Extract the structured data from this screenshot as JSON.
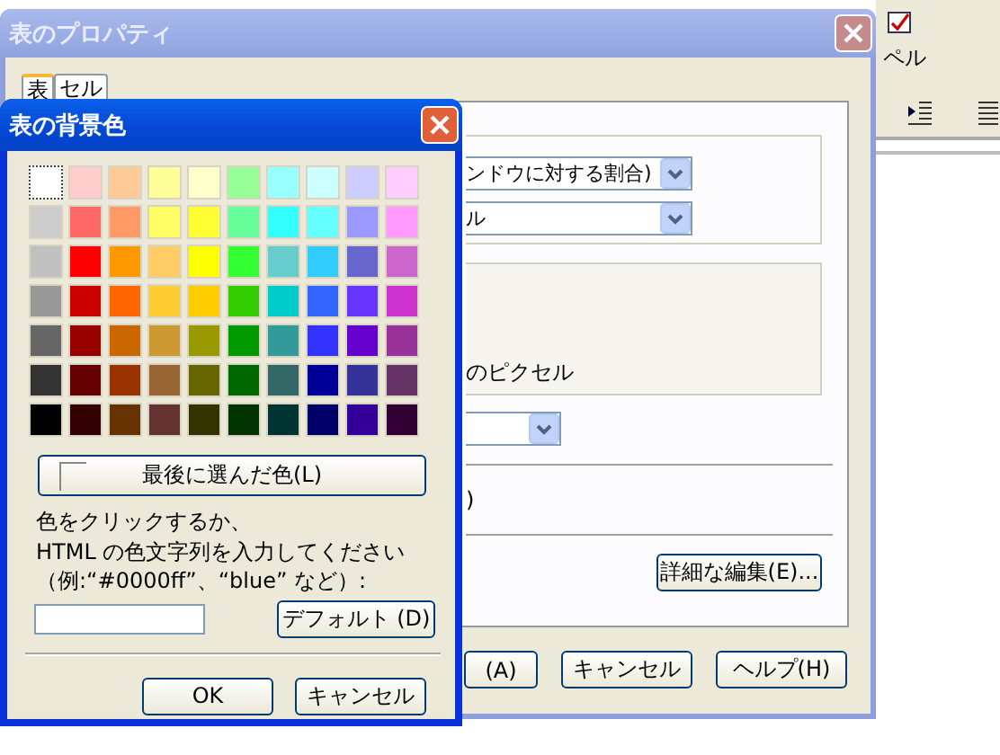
{
  "background_app": {
    "toolbar_label": "ペル"
  },
  "properties_dialog": {
    "title": "表のプロパティ",
    "tabs": [
      {
        "label": "表",
        "selected": true
      },
      {
        "label": "セル",
        "selected": false
      }
    ],
    "size_select": "ンドウに対する割合)",
    "unit_select": "ル",
    "pixel_label": "のピクセル",
    "note_text": ")",
    "advanced_button": "詳細な編集(E)...",
    "buttons": [
      "(A)",
      "キャンセル",
      "ヘルプ(H)"
    ]
  },
  "color_dialog": {
    "title": "表の背景色",
    "palette": [
      {
        "color": "#ffffff",
        "selected": true
      },
      {
        "color": "#ffcccc",
        "selected": false
      },
      {
        "color": "#ffcc99",
        "selected": false
      },
      {
        "color": "#ffff99",
        "selected": false
      },
      {
        "color": "#ffffcc",
        "selected": false
      },
      {
        "color": "#99ff99",
        "selected": false
      },
      {
        "color": "#99ffff",
        "selected": false
      },
      {
        "color": "#ccffff",
        "selected": false
      },
      {
        "color": "#ccccff",
        "selected": false
      },
      {
        "color": "#ffccff",
        "selected": false
      },
      {
        "color": "#cccccc",
        "selected": false
      },
      {
        "color": "#ff6666",
        "selected": false
      },
      {
        "color": "#ff9966",
        "selected": false
      },
      {
        "color": "#ffff66",
        "selected": false
      },
      {
        "color": "#ffff33",
        "selected": false
      },
      {
        "color": "#66ff99",
        "selected": false
      },
      {
        "color": "#33ffff",
        "selected": false
      },
      {
        "color": "#66ffff",
        "selected": false
      },
      {
        "color": "#9999ff",
        "selected": false
      },
      {
        "color": "#ff99ff",
        "selected": false
      },
      {
        "color": "#c0c0c0",
        "selected": false
      },
      {
        "color": "#ff0000",
        "selected": false
      },
      {
        "color": "#ff9900",
        "selected": false
      },
      {
        "color": "#ffcc66",
        "selected": false
      },
      {
        "color": "#ffff00",
        "selected": false
      },
      {
        "color": "#33ff33",
        "selected": false
      },
      {
        "color": "#66cccc",
        "selected": false
      },
      {
        "color": "#33ccff",
        "selected": false
      },
      {
        "color": "#6666cc",
        "selected": false
      },
      {
        "color": "#cc66cc",
        "selected": false
      },
      {
        "color": "#999999",
        "selected": false
      },
      {
        "color": "#cc0000",
        "selected": false
      },
      {
        "color": "#ff6600",
        "selected": false
      },
      {
        "color": "#ffcc33",
        "selected": false
      },
      {
        "color": "#ffcc00",
        "selected": false
      },
      {
        "color": "#33cc00",
        "selected": false
      },
      {
        "color": "#00cccc",
        "selected": false
      },
      {
        "color": "#3366ff",
        "selected": false
      },
      {
        "color": "#6633ff",
        "selected": false
      },
      {
        "color": "#cc33cc",
        "selected": false
      },
      {
        "color": "#666666",
        "selected": false
      },
      {
        "color": "#990000",
        "selected": false
      },
      {
        "color": "#cc6600",
        "selected": false
      },
      {
        "color": "#cc9933",
        "selected": false
      },
      {
        "color": "#999900",
        "selected": false
      },
      {
        "color": "#009900",
        "selected": false
      },
      {
        "color": "#339999",
        "selected": false
      },
      {
        "color": "#3333ff",
        "selected": false
      },
      {
        "color": "#6600cc",
        "selected": false
      },
      {
        "color": "#993399",
        "selected": false
      },
      {
        "color": "#333333",
        "selected": false
      },
      {
        "color": "#660000",
        "selected": false
      },
      {
        "color": "#993300",
        "selected": false
      },
      {
        "color": "#996633",
        "selected": false
      },
      {
        "color": "#666600",
        "selected": false
      },
      {
        "color": "#006600",
        "selected": false
      },
      {
        "color": "#336666",
        "selected": false
      },
      {
        "color": "#000099",
        "selected": false
      },
      {
        "color": "#333399",
        "selected": false
      },
      {
        "color": "#663366",
        "selected": false
      },
      {
        "color": "#000000",
        "selected": false
      },
      {
        "color": "#330000",
        "selected": false
      },
      {
        "color": "#663300",
        "selected": false
      },
      {
        "color": "#663333",
        "selected": false
      },
      {
        "color": "#333300",
        "selected": false
      },
      {
        "color": "#003300",
        "selected": false
      },
      {
        "color": "#003333",
        "selected": false
      },
      {
        "color": "#000066",
        "selected": false
      },
      {
        "color": "#330099",
        "selected": false
      },
      {
        "color": "#330033",
        "selected": false
      }
    ],
    "last_color_button": "最後に選んだ色(L)",
    "instructions": [
      "色をクリックするか、",
      "HTML の色文字列を入力してください",
      "（例:“#0000ff”、“blue” など）:"
    ],
    "default_button": "デフォルト (D)",
    "buttons": [
      "OK",
      "キャンセル"
    ]
  }
}
